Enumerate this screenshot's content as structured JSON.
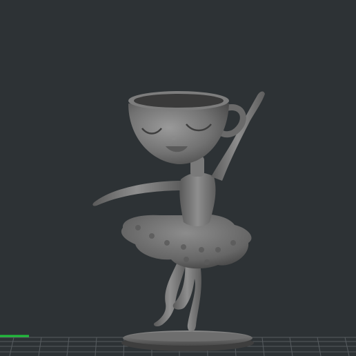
{
  "viewport": {
    "background": "#2d3235",
    "floor_grid_color": "#6a6f73",
    "axis_x_color": "#1fbf3a",
    "model_color": "#7a7a7a",
    "model_shadow": "#4a4a4a",
    "model_highlight": "#a8a8a8",
    "model_name": "ballerina-cup-figurine"
  }
}
